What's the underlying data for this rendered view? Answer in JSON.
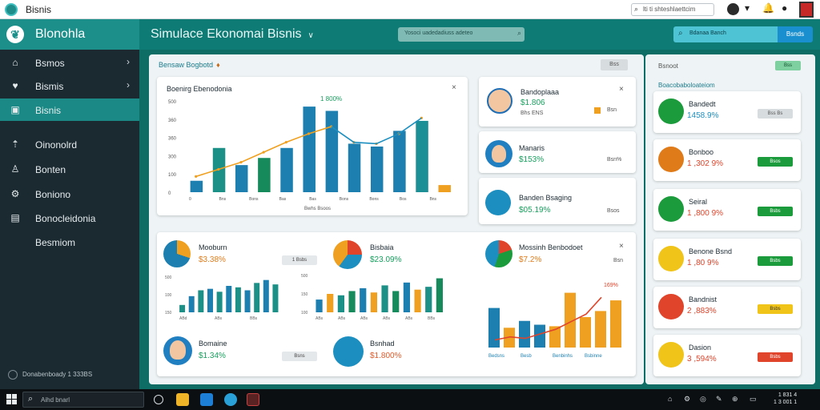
{
  "window": {
    "title": "Bisnis"
  },
  "titlebar": {
    "search_text": "lti ti shteshlaettcim",
    "icons": [
      "search-icon",
      "bell-icon",
      "avatar",
      "chevron-down-icon",
      "notification-icon",
      "flag-icon"
    ]
  },
  "brand": {
    "name": "Blonohla",
    "logo": "leaf-logo-icon"
  },
  "header": {
    "title": "Simulace  Ekonomai  Bisnis",
    "search_placeholder": "Yosoci uadedadiuss adeteo",
    "input_placeholder": "Bdanaa Banch",
    "button_label": "Bsnds"
  },
  "sidebar": {
    "items": [
      {
        "label": "Bsmos",
        "icon": "home-icon",
        "has_arrow": true,
        "active": false
      },
      {
        "label": "Bismis",
        "icon": "heart-icon",
        "has_arrow": true,
        "active": false
      },
      {
        "label": "Bisnis",
        "icon": "briefcase-icon",
        "has_arrow": false,
        "active": true
      },
      {
        "label": "Oinonolrd",
        "icon": "house-icon",
        "has_arrow": false,
        "active": false
      },
      {
        "label": "Bonten",
        "icon": "user-icon",
        "has_arrow": false,
        "active": false
      },
      {
        "label": "Boniono",
        "icon": "settings-icon",
        "has_arrow": false,
        "active": false
      },
      {
        "label": "Bonocleidonia",
        "icon": "grid-icon",
        "has_arrow": false,
        "active": false
      },
      {
        "label": "Besmiom",
        "icon": "",
        "has_arrow": false,
        "active": false
      }
    ],
    "footer": "Donabenboady  1 333BS"
  },
  "section": {
    "title": "Bensaw Bogbotd",
    "pill": "Bss"
  },
  "main_chart": {
    "title": "Boenirg Ebenodoniа",
    "annotation": "1 800%",
    "close": "×",
    "xlabel": "Bwhs Bsoos"
  },
  "chart_data": [
    {
      "type": "bar",
      "title": "Boenirg Ebenodoniа",
      "xlabel": "Bwhs Bsoos",
      "ylabel": "",
      "categories": [
        "0",
        "Bns",
        "Bons",
        "Bas",
        "Bas",
        "Bons",
        "Bons",
        "Bos",
        "Bns"
      ],
      "yticks": [
        "0",
        "100",
        "300",
        "360",
        "360",
        "500"
      ],
      "values": [
        40,
        155,
        95,
        120,
        155,
        300,
        285,
        170,
        160,
        215,
        250,
        25
      ],
      "line_values": [
        55,
        80,
        105,
        140,
        175,
        205,
        230,
        175,
        170,
        205,
        260
      ],
      "annotation": "1 800%"
    },
    {
      "type": "bar",
      "values": [
        10,
        22,
        30,
        32,
        28,
        36,
        34,
        30,
        40,
        44,
        38
      ],
      "yticks": [
        "150",
        "100",
        "500"
      ],
      "categories": [
        "ABd",
        "ABs",
        "BBs"
      ]
    },
    {
      "type": "bar",
      "values": [
        18,
        26,
        24,
        30,
        34,
        28,
        38,
        30,
        42,
        32,
        36,
        48
      ],
      "yticks": [
        "100",
        "150",
        "500"
      ],
      "categories": [
        "ABs",
        "ABs",
        "ABs",
        "ABs",
        "ABs",
        "BBs"
      ]
    },
    {
      "type": "bar",
      "categories": [
        "Bedsns",
        "Besb",
        "Benbinhs",
        "Bsbinne"
      ],
      "values": [
        52,
        26,
        35,
        30,
        28,
        72,
        40,
        48,
        62
      ],
      "line_values": [
        10,
        14,
        12,
        18,
        24,
        34,
        44,
        66
      ],
      "yticks": [
        "100",
        "150",
        "500"
      ],
      "annotation": "169%"
    }
  ],
  "cards_top": [
    {
      "name": "Bandoplaaa",
      "value": "$1.806",
      "sub": "Bhs ENS",
      "pill": "Bsn",
      "value_color": "#17a05d"
    },
    {
      "name": "Manaris",
      "value": "$153%",
      "sub": "",
      "pill": "Bsn%",
      "value_color": "#17a05d"
    },
    {
      "name": "Banden Bsaging",
      "value": "$05.19%",
      "sub": "",
      "pill": "Bsos",
      "value_color": "#17a05d"
    }
  ],
  "cards_bottom": [
    {
      "name": "Mooburn",
      "value": "$3.38%",
      "pill": "1 Bsbs",
      "value_color": "#e07b1a"
    },
    {
      "name": "Bisbaia",
      "value": "$23.09%",
      "pill": "",
      "value_color": "#17a05d"
    },
    {
      "name": "Mossinh Benbodoet",
      "value": "$7.2%",
      "pill": "Bsn",
      "value_color": "#e07b1a"
    },
    {
      "name": "Bomaine",
      "value": "$1.34%",
      "pill": "Bsns",
      "value_color": "#17a05d"
    },
    {
      "name": "Bsnhad",
      "value": "$1.800%",
      "pill": "",
      "value_color": "#e05a2a"
    }
  ],
  "right_panel": {
    "title": "Bsnoot",
    "pill": "Bss",
    "header": "Boacobaboloateiom",
    "items": [
      {
        "name": "Bandedt",
        "value": "1458.9%",
        "pill": "Bss Bs",
        "icon": "green-check-icon",
        "value_color": "#1c8fc0",
        "pill_color": "#d7dcde",
        "pill_text_color": "#555"
      },
      {
        "name": "Bonboo",
        "value": "1 ,302 9%",
        "pill": "Bsos",
        "icon": "orange-stat-icon",
        "value_color": "#e0442a",
        "pill_color": "#1c9b3c",
        "pill_text_color": "#fff"
      },
      {
        "name": "Seiral",
        "value": "1 ,800 9%",
        "pill": "Bsbs",
        "icon": "green-chart-icon",
        "value_color": "#e0442a",
        "pill_color": "#1c9b3c",
        "pill_text_color": "#fff"
      },
      {
        "name": "Benone Bsnd",
        "value": "1 ,80 9%",
        "pill": "Bsbs",
        "icon": "person-icon",
        "value_color": "#e0442a",
        "pill_color": "#1c9b3c",
        "pill_text_color": "#fff"
      },
      {
        "name": "Bandnist",
        "value": "2 ,883%",
        "pill": "Bsbs",
        "icon": "red-graph-icon",
        "value_color": "#e0442a",
        "pill_color": "#f0c419",
        "pill_text_color": "#333"
      },
      {
        "name": "Dasion",
        "value": "3 ,594%",
        "pill": "Bsbs",
        "icon": "yellow-box-icon",
        "value_color": "#e0442a",
        "pill_color": "#e0442a",
        "pill_text_color": "#fff"
      }
    ]
  },
  "taskbar": {
    "search_placeholder": "Aihd bnarl",
    "clock_line1": "1 831 4",
    "clock_line2": "1 3 001 1"
  }
}
